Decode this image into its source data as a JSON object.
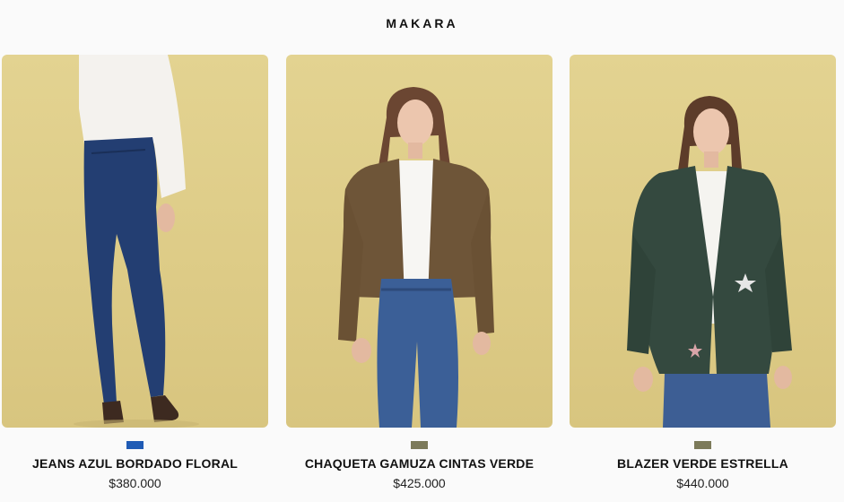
{
  "header": {
    "brand": "MAKARA"
  },
  "products": [
    {
      "name": "JEANS AZUL BORDADO FLORAL",
      "price": "$380.000",
      "color_swatch": "#1f5bb5",
      "image": "model-back-view-blue-jeans-white-shirt"
    },
    {
      "name": "CHAQUETA GAMUZA CINTAS VERDE",
      "price": "$425.000",
      "color_swatch": "#7c7a5a",
      "image": "model-front-brown-suede-jacket-jeans"
    },
    {
      "name": "BLAZER VERDE ESTRELLA",
      "price": "$440.000",
      "color_swatch": "#7c7a5a",
      "image": "model-front-green-blazer-star-jeans"
    }
  ],
  "colors": {
    "background": "#fafafa",
    "photo_bg": "#e0cf8b"
  }
}
